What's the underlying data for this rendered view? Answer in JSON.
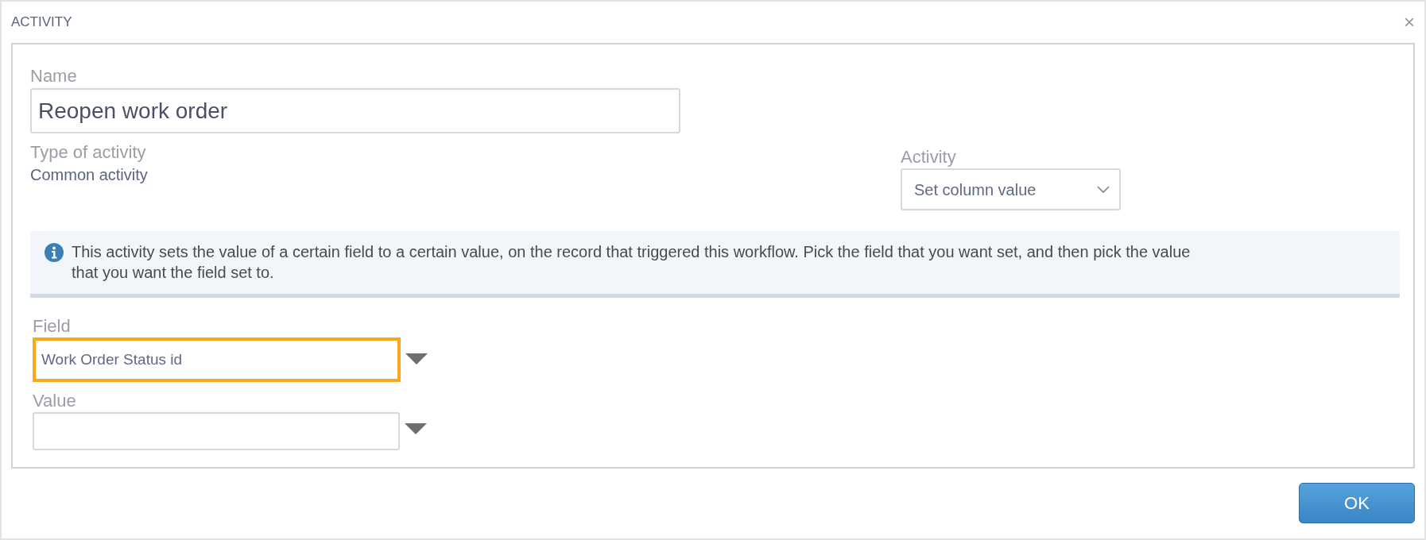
{
  "dialog": {
    "title": "ACTIVITY",
    "close": "×"
  },
  "name": {
    "label": "Name",
    "value": "Reopen work order"
  },
  "type_of_activity": {
    "label": "Type of activity",
    "value": "Common activity"
  },
  "activity": {
    "label": "Activity",
    "value": "Set column value"
  },
  "info": "This activity sets the value of a certain field to a certain value, on the record that triggered this workflow. Pick the field that you want set, and then pick the value that you want the field set to.",
  "fields": [
    {
      "label": "Field",
      "value": "Work Order Status id",
      "focused": true
    },
    {
      "label": "Value",
      "focused": false
    }
  ],
  "buttons": [
    "OK"
  ]
}
